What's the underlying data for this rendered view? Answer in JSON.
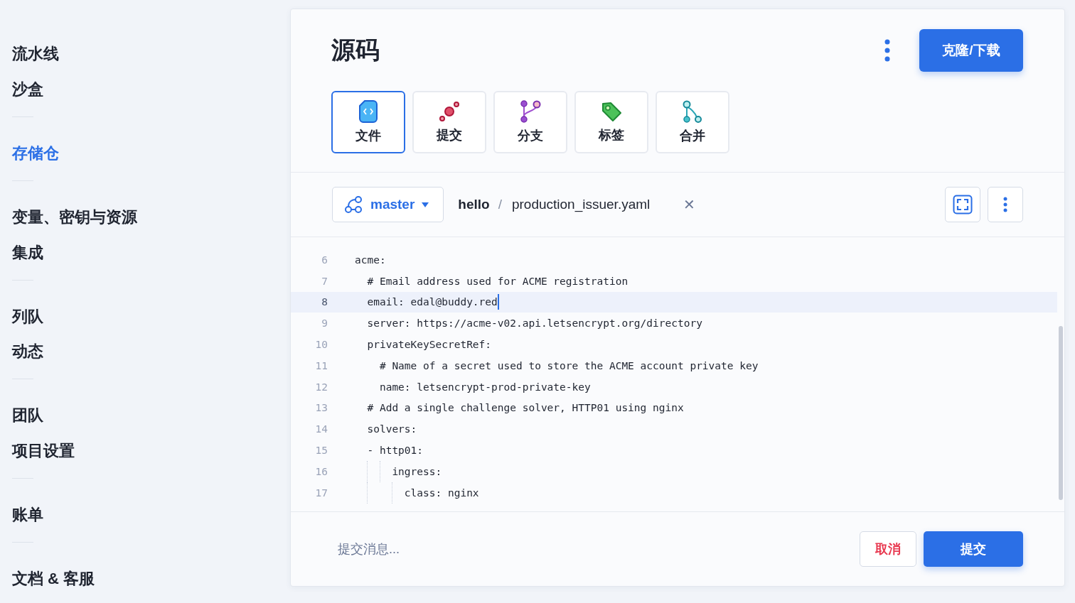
{
  "sidebar": {
    "groups": [
      [
        {
          "label": "流水线",
          "selected": false
        },
        {
          "label": "沙盒",
          "selected": false
        }
      ],
      [
        {
          "label": "存储仓",
          "selected": true
        }
      ],
      [
        {
          "label": "变量、密钥与资源",
          "selected": false
        },
        {
          "label": "集成",
          "selected": false
        }
      ],
      [
        {
          "label": "列队",
          "selected": false
        },
        {
          "label": "动态",
          "selected": false
        }
      ],
      [
        {
          "label": "团队",
          "selected": false
        },
        {
          "label": "项目设置",
          "selected": false
        }
      ],
      [
        {
          "label": "账单",
          "selected": false
        }
      ],
      [
        {
          "label": "文档 & 客服",
          "selected": false
        }
      ]
    ]
  },
  "header": {
    "title": "源码",
    "clone_button": "克隆/下载"
  },
  "tabs": [
    {
      "kind": "file",
      "label": "文件",
      "selected": true
    },
    {
      "kind": "commit",
      "label": "提交",
      "selected": false
    },
    {
      "kind": "branch",
      "label": "分支",
      "selected": false
    },
    {
      "kind": "tag",
      "label": "标签",
      "selected": false
    },
    {
      "kind": "merge",
      "label": "合并",
      "selected": false
    }
  ],
  "path_bar": {
    "branch": "master",
    "folder": "hello",
    "separator": "/",
    "file": "production_issuer.yaml",
    "close": "✕"
  },
  "code_lines": [
    {
      "number": "6",
      "text": "acme:",
      "selected": false
    },
    {
      "number": "7",
      "text": "  # Email address used for ACME registration",
      "selected": false
    },
    {
      "number": "8",
      "text": "  email: edal@buddy.red",
      "selected": true
    },
    {
      "number": "9",
      "text": "  server: https://acme-v02.api.letsencrypt.org/directory",
      "selected": false
    },
    {
      "number": "10",
      "text": "  privateKeySecretRef:",
      "selected": false
    },
    {
      "number": "11",
      "text": "    # Name of a secret used to store the ACME account private key",
      "selected": false
    },
    {
      "number": "12",
      "text": "    name: letsencrypt-prod-private-key",
      "selected": false
    },
    {
      "number": "13",
      "text": "  # Add a single challenge solver, HTTP01 using nginx",
      "selected": false
    },
    {
      "number": "14",
      "text": "  solvers:",
      "selected": false
    },
    {
      "number": "15",
      "text": "  - http01:",
      "selected": false
    },
    {
      "number": "16",
      "text": "      ingress:",
      "selected": false
    },
    {
      "number": "17",
      "text": "        class: nginx",
      "selected": false
    }
  ],
  "footer": {
    "placeholder": "提交消息...",
    "cancel": "取消",
    "submit": "提交"
  }
}
